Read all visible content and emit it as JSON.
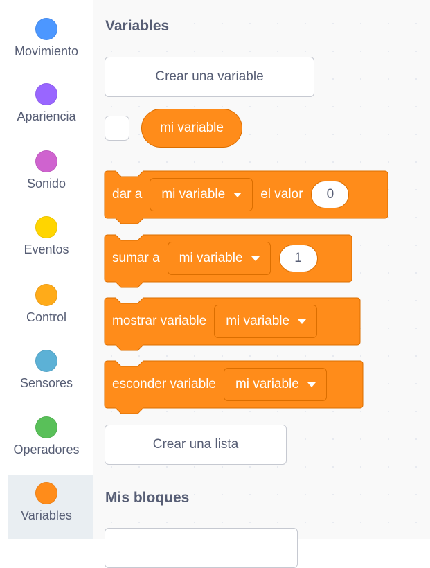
{
  "categories": [
    {
      "label": "Movimiento",
      "color": "#4c97ff",
      "icon": "motion-category-dot-icon"
    },
    {
      "label": "Apariencia",
      "color": "#9966ff",
      "icon": "looks-category-dot-icon"
    },
    {
      "label": "Sonido",
      "color": "#cf63cf",
      "icon": "sound-category-dot-icon"
    },
    {
      "label": "Eventos",
      "color": "#ffd500",
      "icon": "events-category-dot-icon"
    },
    {
      "label": "Control",
      "color": "#ffab19",
      "icon": "control-category-dot-icon"
    },
    {
      "label": "Sensores",
      "color": "#5cb1d6",
      "icon": "sensing-category-dot-icon"
    },
    {
      "label": "Operadores",
      "color": "#59c059",
      "icon": "operators-category-dot-icon"
    },
    {
      "label": "Variables",
      "color": "#ff8c1a",
      "icon": "variables-category-dot-icon",
      "selected": true
    }
  ],
  "flyout": {
    "variables_heading": "Variables",
    "create_variable_button": "Crear una variable",
    "reporter_label": "mi variable",
    "blocks": {
      "set": {
        "prefix": "dar a",
        "variable": "mi variable",
        "middle": "el valor",
        "value": "0"
      },
      "change": {
        "prefix": "sumar a",
        "variable": "mi variable",
        "value": "1"
      },
      "show": {
        "prefix": "mostrar variable",
        "variable": "mi variable"
      },
      "hide": {
        "prefix": "esconder variable",
        "variable": "mi variable"
      }
    },
    "create_list_button": "Crear una lista",
    "my_blocks_heading": "Mis bloques"
  },
  "colors": {
    "variables_block": "#ff8c1a",
    "variables_block_border": "#db6e00",
    "sidebar_text": "#575e75",
    "selected_category_bg": "#e9eef2"
  }
}
